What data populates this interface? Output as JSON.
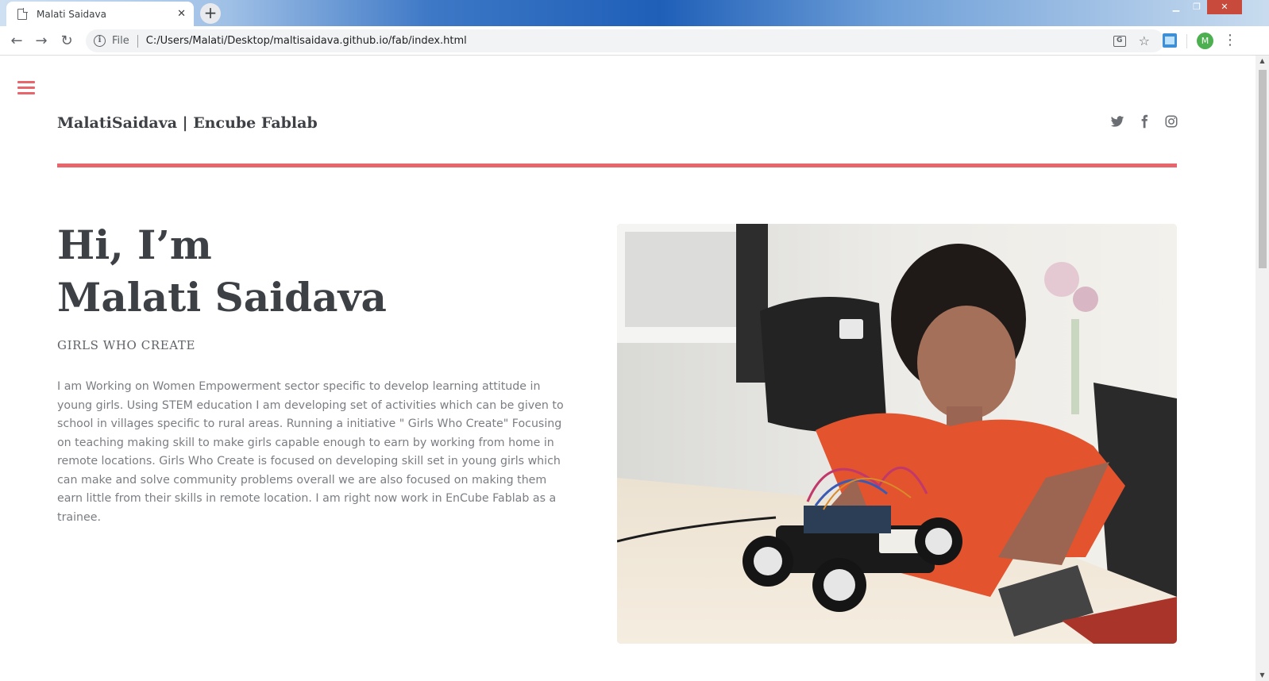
{
  "browser": {
    "tab_title": "Malati Saidava",
    "new_tab_label": "+",
    "scheme": "File",
    "url": "C:/Users/Malati/Desktop/maltisaidava.github.io/fab/index.html",
    "profile_initial": "M"
  },
  "site": {
    "title": "MalatiSaidava | Encube Fablab",
    "social": [
      "twitter-icon",
      "facebook-icon",
      "instagram-icon"
    ],
    "accent_color": "#e8656b"
  },
  "hero": {
    "greeting_line1": "Hi, I’m",
    "greeting_line2": "Malati Saidava",
    "subtitle": "GIRLS WHO CREATE",
    "body": "I am Working on Women Empowerment sector specific to develop learning attitude in young girls. Using STEM education I am developing set of activities which can be given to school in villages specific to rural areas. Running a initiative \" Girls Who Create\" Focusing on teaching making skill to make girls capable enough to earn by working from home in remote locations. Girls Who Create is focused on developing skill set in young girls which can make and solve community problems overall we are also focused on making them earn little from their skills in remote location. I am right now work in EnCube Fablab as a trainee."
  }
}
